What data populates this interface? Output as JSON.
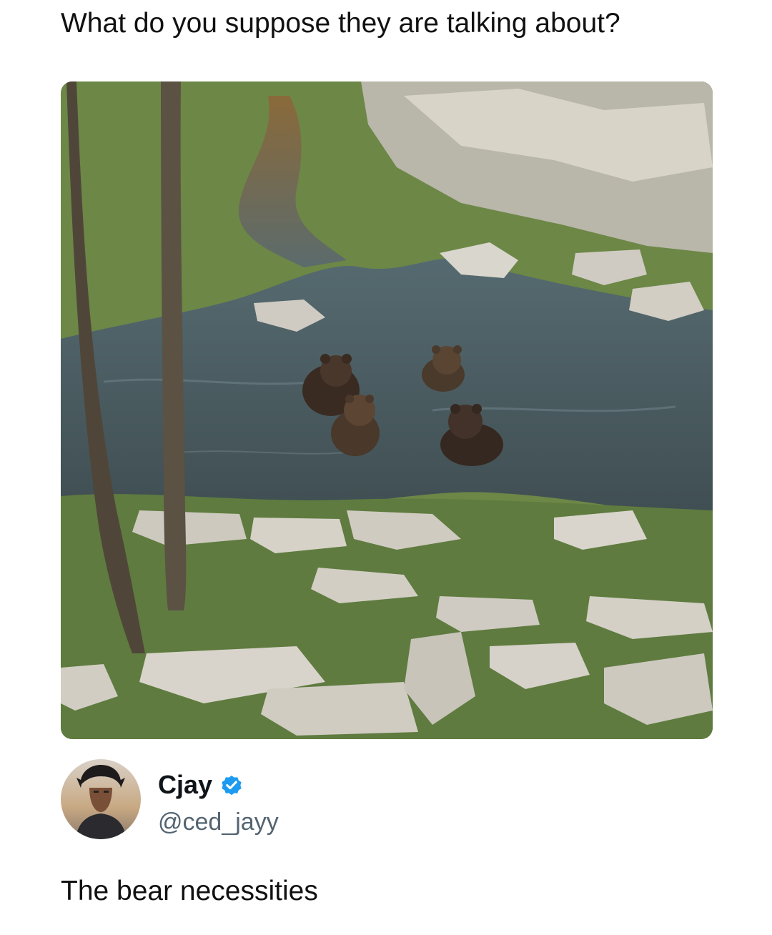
{
  "post": {
    "text": "What do you suppose they are talking about?",
    "image": {
      "alt_subject": "four bears in a pond among rocks and grass",
      "colors": {
        "water": "#4a5a5e",
        "grass": "#6f8a4a",
        "rock": "#cfcbc2"
      }
    }
  },
  "reply": {
    "author": {
      "display_name": "Cjay",
      "handle": "@ced_jayy",
      "verified": true,
      "verified_color": "#1d9bf0",
      "avatar_icon": "anime-character-avatar"
    },
    "text": "The bear necessities"
  }
}
